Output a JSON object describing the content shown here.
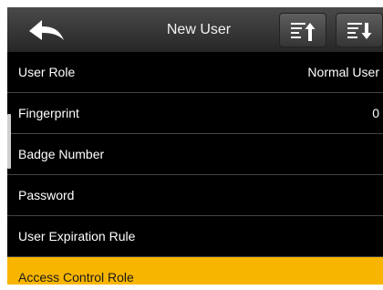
{
  "header": {
    "title": "New User",
    "back_icon": "back-arrow-icon",
    "page_up_icon": "page-up-icon",
    "page_down_icon": "page-down-icon"
  },
  "rows": [
    {
      "label": "User Role",
      "value": "Normal User"
    },
    {
      "label": "Fingerprint",
      "value": "0"
    },
    {
      "label": "Badge Number",
      "value": ""
    },
    {
      "label": "Password",
      "value": ""
    },
    {
      "label": "User Expiration Rule",
      "value": ""
    },
    {
      "label": "Access Control Role",
      "value": ""
    }
  ],
  "selected_row": "Access Control Role",
  "colors": {
    "background": "#000000",
    "header": "#333333",
    "highlight": "#f7b500",
    "text": "#ffffff"
  }
}
